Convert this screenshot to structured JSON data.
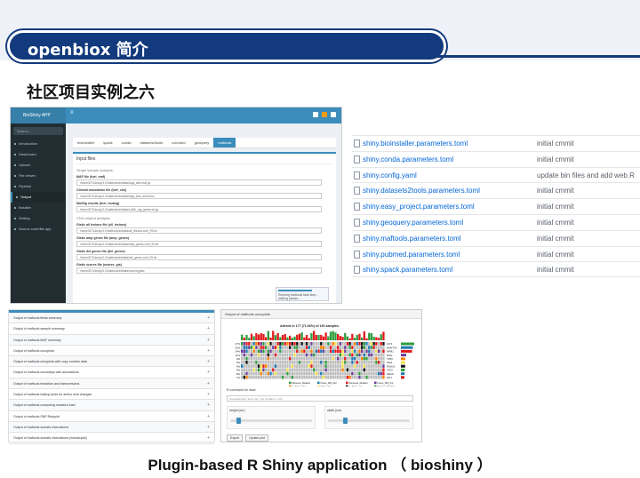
{
  "slide": {
    "header_title": "openbiox 简介",
    "subtitle": "社区项目实例之六",
    "caption": "Plugin-based R Shiny application （ bioshiny ）"
  },
  "app": {
    "logo": "BioShiny APP",
    "hamburger": "≡",
    "search_placeholder": "Search...",
    "sidebar": [
      "Introduction",
      "Dashboard",
      "Upload",
      "File viewer",
      "Pipeline",
      "Output",
      "Installer",
      "Setting",
      "Source code/file app"
    ],
    "active_sidebar_index": 5,
    "tabs": [
      "bioinstaller",
      "spack",
      "conda",
      "datasets2tools",
      "colorand",
      "geoquery",
      "maftools"
    ],
    "active_tab": "maftools",
    "panel_title": "Input files",
    "section1": "Single sample analysis:",
    "fields1": [
      {
        "label": "MAF file (fuel_maf)",
        "value": "/home/l27/Library/1.0/maftools/extdata/tcga_laml.maf.gz"
      },
      {
        "label": "Clinical annotation file (fuel_clin)",
        "value": "/home/l27/Library/1.0/maftools/extdata/tcga_laml_annot.tsv"
      },
      {
        "label": "MutSig results (fuel_mutsig)",
        "value": "/home/l27/Library/1.0/maftools/extdata/LAML_sig_genes.txt.gz"
      }
    ],
    "section2": "CNV-related analysis:",
    "fields2": [
      {
        "label": "Gistic all lesions file (all_lesions)",
        "value": "/home/l27/Library/1.0/maftools/extdata/all_lesions.conf_99.txt"
      },
      {
        "label": "Gistic amp genes file (amp_genes)",
        "value": "/home/l27/Library/1.0/maftools/extdata/amp_genes.conf_99.txt"
      },
      {
        "label": "Gistic del genes file (del_genes)",
        "value": "/home/l27/Library/1.0/maftools/extdata/del_genes.conf_99.txt"
      },
      {
        "label": "Gistic scores file (scores_gis)",
        "value": "/home/l27/Library/1.0/maftools/extdata/scores.gistic"
      }
    ],
    "toast_text": "Running maftools task step... waiting please..."
  },
  "files": [
    {
      "name": "shiny.bioinstaller.parameters.toml",
      "message": "initial cmmit"
    },
    {
      "name": "shiny.conda.parameters.toml",
      "message": "initial cmmit"
    },
    {
      "name": "shiny.config.yaml",
      "message": "update bin files and add web.R"
    },
    {
      "name": "shiny.datasets2tools.parameters.toml",
      "message": "initial cmmit"
    },
    {
      "name": "shiny.easy_project.parameters.toml",
      "message": "initial cmmit"
    },
    {
      "name": "shiny.geoquery.parameters.toml",
      "message": "initial cmmit"
    },
    {
      "name": "shiny.maftools.parameters.toml",
      "message": "initial cmmit"
    },
    {
      "name": "shiny.pubmed.parameters.toml",
      "message": "initial cmmit"
    },
    {
      "name": "shiny.spack.parameters.toml",
      "message": "initial cmmit"
    }
  ],
  "accordion": [
    "Output of maftools fields summary",
    "Output of maftools sample summary",
    "Output of maftools MAF summary",
    "Output of maftools oncoplots",
    "Output of maftools oncoplots with copy number data",
    "Output of maftools oncostrips with annotations",
    "Output of maftools transition and transversions",
    "Output of maftools lollipop plots for amino acid changes",
    "Output of maftools computing mutation load",
    "Output of maftools SNP Rainplot",
    "Output of maftools somatic interactions",
    "Output of maftools somatic interactions (mosaicplot)"
  ],
  "onco": {
    "head": "Output of maftools oncoplots",
    "plot_title": "Altered in 177 (71.66%) of 193 samples.",
    "genes": [
      "FLT3",
      "DNMT3A",
      "NPM1",
      "IDH2",
      "TP53",
      "IDH1",
      "RUNX1",
      "TET2",
      "NRAS",
      "WT1"
    ],
    "pcts": [
      "27%",
      "25%",
      "24%",
      "11%",
      "9%",
      "9%",
      "9%",
      "9%",
      "8%",
      "7%"
    ],
    "legend": [
      "Missense_Mutation",
      "Frame_Shift_Del",
      "Nonsense_Mutation",
      "Frame_Shift_Ins",
      "In_Frame_Del",
      "Splice_Site",
      "In_Frame_Ins",
      "Nonstop_Mutation"
    ],
    "colors": {
      "missense": "#2e9c3f",
      "fs_del": "#1f78b4",
      "nonsense": "#e31a1c",
      "fs_ins": "#6a3d9a",
      "ifd": "#ff7f00",
      "splice": "#f4e04d",
      "multi": "#111111",
      "empty": "#bdbdbd"
    },
    "input_caption": "R command for draw",
    "input_value": "oncoplot(maf = laml, top = 10, fontSize = 0.6)",
    "slider1_label": "height (cm)",
    "slider2_label": "width (cm)",
    "btn1": "Export",
    "btn2": "Update plot"
  }
}
